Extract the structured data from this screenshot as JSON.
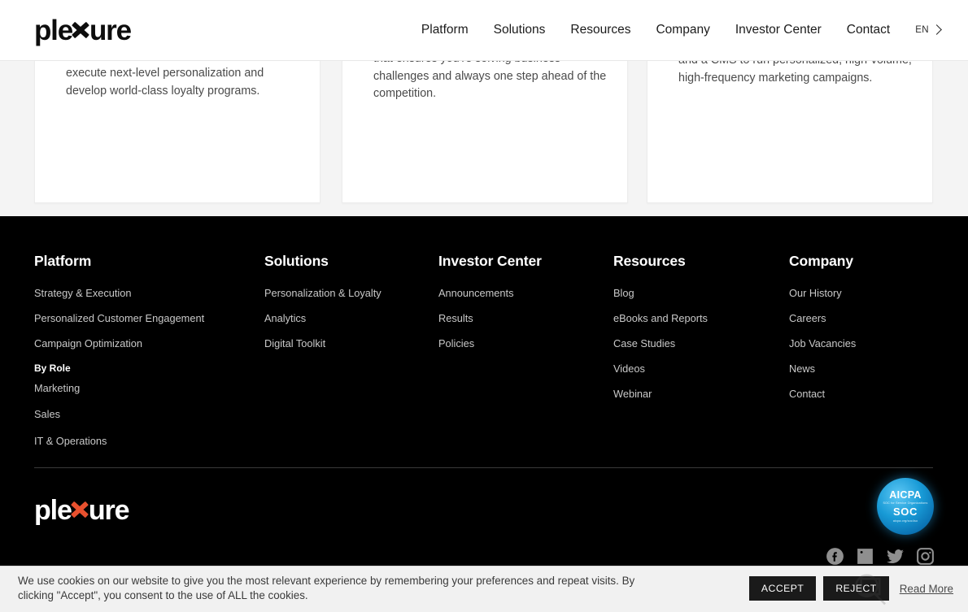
{
  "header": {
    "logo_text": "plexure",
    "nav": [
      {
        "label": "Platform"
      },
      {
        "label": "Solutions"
      },
      {
        "label": "Resources"
      },
      {
        "label": "Company"
      },
      {
        "label": "Investor Center"
      },
      {
        "label": "Contact"
      }
    ],
    "language": {
      "label": "EN",
      "icon": "chevron-right-icon"
    }
  },
  "main": {
    "cards": [
      {
        "text": "execute next-level personalization and develop world-class loyalty programs."
      },
      {
        "text": "that ensures you're solving business challenges and always one step ahead of the competition."
      },
      {
        "text": "and a CMS to run personalized, high-volume, high-frequency marketing campaigns."
      }
    ]
  },
  "footer": {
    "columns": [
      {
        "title": "Platform",
        "links": [
          {
            "label": "Strategy & Execution",
            "type": "link"
          },
          {
            "label": "Personalized Customer Engagement",
            "type": "link"
          },
          {
            "label": "Campaign Optimization",
            "type": "link"
          },
          {
            "label": "By Role",
            "type": "subheading"
          },
          {
            "label": "Marketing",
            "type": "link"
          },
          {
            "label": "Sales",
            "type": "link"
          },
          {
            "label": "IT & Operations",
            "type": "link"
          }
        ]
      },
      {
        "title": "Solutions",
        "links": [
          {
            "label": "Personalization & Loyalty",
            "type": "link"
          },
          {
            "label": "Analytics",
            "type": "link"
          },
          {
            "label": "Digital Toolkit",
            "type": "link"
          }
        ]
      },
      {
        "title": "Investor Center",
        "links": [
          {
            "label": "Announcements",
            "type": "link"
          },
          {
            "label": "Results",
            "type": "link"
          },
          {
            "label": "Policies",
            "type": "link"
          }
        ]
      },
      {
        "title": "Resources",
        "links": [
          {
            "label": "Blog",
            "type": "link"
          },
          {
            "label": "eBooks and Reports",
            "type": "link"
          },
          {
            "label": "Case Studies",
            "type": "link"
          },
          {
            "label": "Videos",
            "type": "link"
          },
          {
            "label": "Webinar",
            "type": "link"
          }
        ]
      },
      {
        "title": "Company",
        "links": [
          {
            "label": "Our History",
            "type": "link"
          },
          {
            "label": "Careers",
            "type": "link"
          },
          {
            "label": "Job Vacancies",
            "type": "link"
          },
          {
            "label": "News",
            "type": "link"
          },
          {
            "label": "Contact",
            "type": "link"
          }
        ]
      }
    ],
    "logo_text": "plexure",
    "badge": {
      "line1": "AICPA",
      "line1_sub": "SOC for Service Organizations",
      "line2": "SOC",
      "line3": "aicpa.org/soc4so"
    },
    "socials": [
      {
        "name": "facebook-icon"
      },
      {
        "name": "linkedin-icon"
      },
      {
        "name": "twitter-icon"
      },
      {
        "name": "instagram-icon"
      }
    ]
  },
  "cookie_banner": {
    "message": "We use cookies on our website to give you the most relevant experience by remembering your preferences and repeat visits. By clicking \"Accept\", you consent to the use of ALL the cookies.",
    "accept_label": "ACCEPT",
    "reject_label": "REJECT",
    "readmore_label": "Read More"
  },
  "colors": {
    "accent": "#e8502e",
    "footer_bg": "#000000",
    "page_bg": "#f4f4f4",
    "badge_blue": "#189ad6"
  }
}
